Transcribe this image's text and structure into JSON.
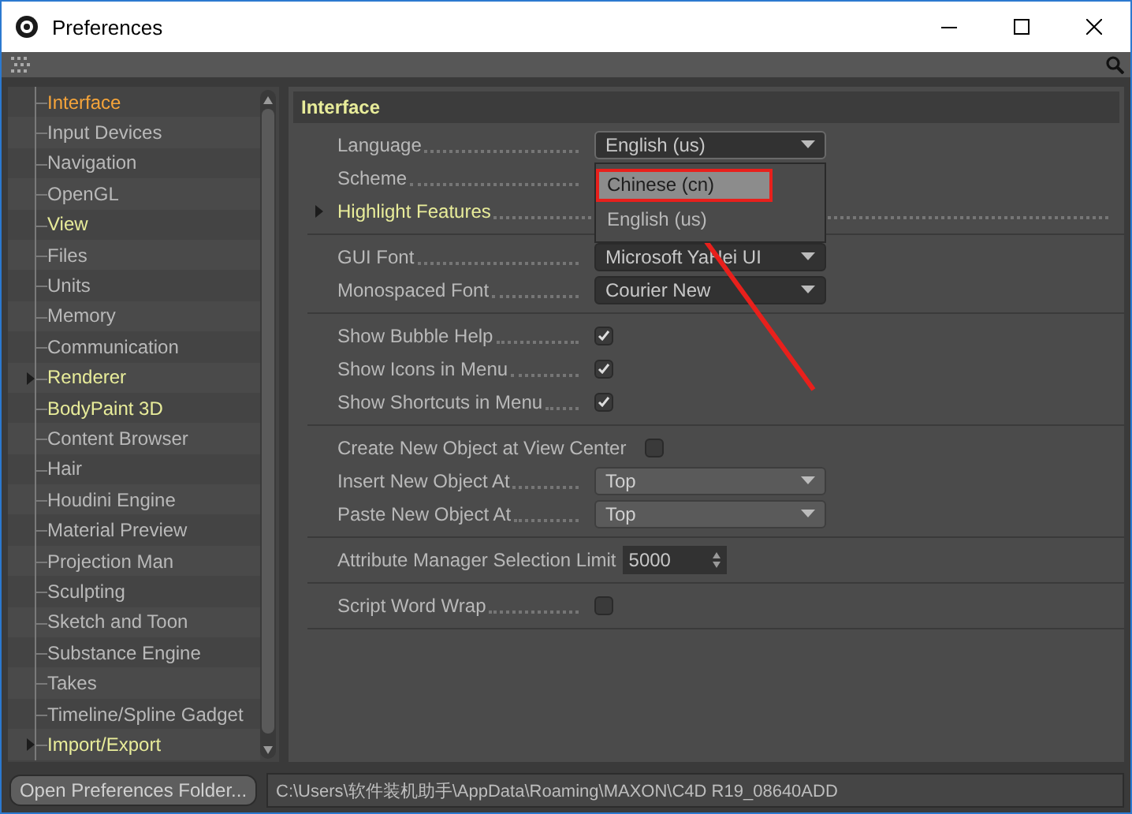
{
  "window": {
    "title": "Preferences"
  },
  "sidebar": {
    "items": [
      {
        "label": "Interface",
        "selected": true,
        "highlighted": false,
        "expandable": false
      },
      {
        "label": "Input Devices",
        "selected": false,
        "highlighted": false,
        "expandable": false
      },
      {
        "label": "Navigation",
        "selected": false,
        "highlighted": false,
        "expandable": false
      },
      {
        "label": "OpenGL",
        "selected": false,
        "highlighted": false,
        "expandable": false
      },
      {
        "label": "View",
        "selected": false,
        "highlighted": true,
        "expandable": false
      },
      {
        "label": "Files",
        "selected": false,
        "highlighted": false,
        "expandable": false
      },
      {
        "label": "Units",
        "selected": false,
        "highlighted": false,
        "expandable": false
      },
      {
        "label": "Memory",
        "selected": false,
        "highlighted": false,
        "expandable": false
      },
      {
        "label": "Communication",
        "selected": false,
        "highlighted": false,
        "expandable": false
      },
      {
        "label": "Renderer",
        "selected": false,
        "highlighted": true,
        "expandable": true
      },
      {
        "label": "BodyPaint 3D",
        "selected": false,
        "highlighted": true,
        "expandable": false
      },
      {
        "label": "Content Browser",
        "selected": false,
        "highlighted": false,
        "expandable": false
      },
      {
        "label": "Hair",
        "selected": false,
        "highlighted": false,
        "expandable": false
      },
      {
        "label": "Houdini Engine",
        "selected": false,
        "highlighted": false,
        "expandable": false
      },
      {
        "label": "Material Preview",
        "selected": false,
        "highlighted": false,
        "expandable": false
      },
      {
        "label": "Projection Man",
        "selected": false,
        "highlighted": false,
        "expandable": false
      },
      {
        "label": "Sculpting",
        "selected": false,
        "highlighted": false,
        "expandable": false
      },
      {
        "label": "Sketch and Toon",
        "selected": false,
        "highlighted": false,
        "expandable": false
      },
      {
        "label": "Substance Engine",
        "selected": false,
        "highlighted": false,
        "expandable": false
      },
      {
        "label": "Takes",
        "selected": false,
        "highlighted": false,
        "expandable": false
      },
      {
        "label": "Timeline/Spline Gadget",
        "selected": false,
        "highlighted": false,
        "expandable": false
      },
      {
        "label": "Import/Export",
        "selected": false,
        "highlighted": true,
        "expandable": true
      }
    ]
  },
  "panel": {
    "title": "Interface",
    "groups": [
      [
        {
          "kind": "dropdown",
          "label": "Language",
          "value": "English (us)",
          "open": true
        },
        {
          "kind": "label",
          "label": "Scheme"
        },
        {
          "kind": "section",
          "label": "Highlight Features"
        }
      ],
      [
        {
          "kind": "dropdown",
          "label": "GUI Font",
          "value": "Microsoft YaHei UI",
          "open": false
        },
        {
          "kind": "dropdown",
          "label": "Monospaced Font",
          "value": "Courier New",
          "open": false
        }
      ],
      [
        {
          "kind": "checkbox",
          "label": "Show Bubble Help",
          "checked": true
        },
        {
          "kind": "checkbox",
          "label": "Show Icons in Menu",
          "checked": true
        },
        {
          "kind": "checkbox",
          "label": "Show Shortcuts in Menu",
          "checked": true
        }
      ],
      [
        {
          "kind": "checkbox",
          "label": "Create New Object at View Center",
          "checked": false
        },
        {
          "kind": "dropdown",
          "label": "Insert New Object At",
          "value": "Top",
          "open": false
        },
        {
          "kind": "dropdown",
          "label": "Paste New Object At",
          "value": "Top",
          "open": false
        }
      ],
      [
        {
          "kind": "number",
          "label": "Attribute Manager Selection Limit",
          "value": "5000"
        }
      ],
      [
        {
          "kind": "checkbox",
          "label": "Script Word Wrap",
          "checked": false
        }
      ]
    ]
  },
  "dropdown_menu": {
    "options": [
      {
        "label": "Chinese (cn)",
        "selected": true,
        "marked": true
      },
      {
        "label": "English (us)",
        "selected": false,
        "marked": false
      }
    ]
  },
  "bottom_bar": {
    "button": "Open Preferences Folder...",
    "path": "C:\\Users\\软件装机助手\\AppData\\Roaming\\MAXON\\C4D R19_08640ADD"
  }
}
